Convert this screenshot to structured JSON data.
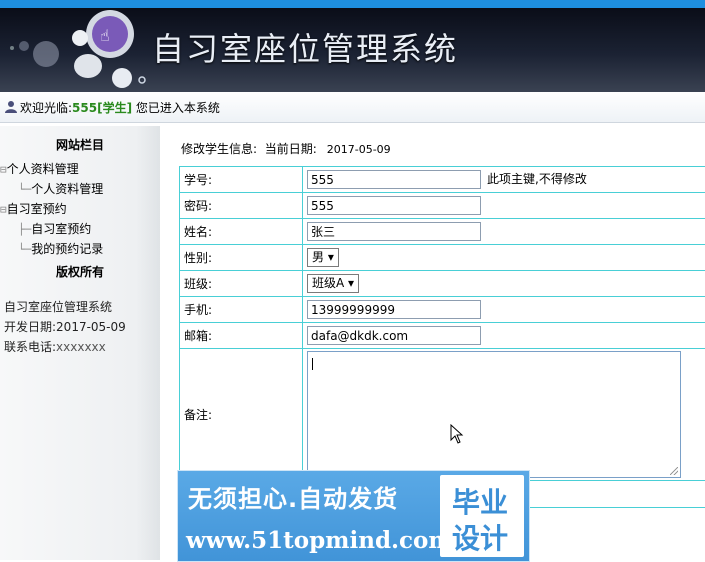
{
  "app": {
    "title": "自习室座位管理系统"
  },
  "welcome": {
    "prefix": "欢迎光临:",
    "user": "555[学生]",
    "suffix": "您已进入本系统"
  },
  "sidebar": {
    "section_title": "网站栏目",
    "tree": [
      {
        "label": "个人资料管理",
        "children": [
          "个人资料管理"
        ]
      },
      {
        "label": "自习室预约",
        "children": [
          "自习室预约",
          "我的预约记录"
        ]
      }
    ],
    "copyright_title": "版权所有",
    "info": {
      "system_name": "自习室座位管理系统",
      "dev_date": "开发日期:2017-05-09",
      "phone_label": "联系电话:",
      "phone_value": "xxxxxxx"
    }
  },
  "form": {
    "heading": "修改学生信息:",
    "date_label": "当前日期:",
    "date": "2017-05-09",
    "fields": {
      "xuehao": {
        "label": "学号:",
        "value": "555",
        "note": "此项主键,不得修改"
      },
      "mima": {
        "label": "密码:",
        "value": "555"
      },
      "xingming": {
        "label": "姓名:",
        "value": "张三"
      },
      "xingbie": {
        "label": "性别:",
        "value": "男 ▾"
      },
      "banji": {
        "label": "班级:",
        "value": "班级A ▾"
      },
      "shouji": {
        "label": "手机:",
        "value": "13999999999"
      },
      "youxiang": {
        "label": "邮箱:",
        "value": "dafa@dkdk.com"
      },
      "beizhu": {
        "label": "备注:",
        "value": ""
      }
    }
  },
  "watermark": {
    "slogan": "无须担心.自动发货",
    "url": "www.51topmind.com",
    "badge_line1": "毕业",
    "badge_line2": "设计"
  },
  "colors": {
    "topbar": "#1e8fe0",
    "table_border": "#49cfd6",
    "user_green": "#2a8a1e",
    "watermark_blue": "#4194d8"
  }
}
